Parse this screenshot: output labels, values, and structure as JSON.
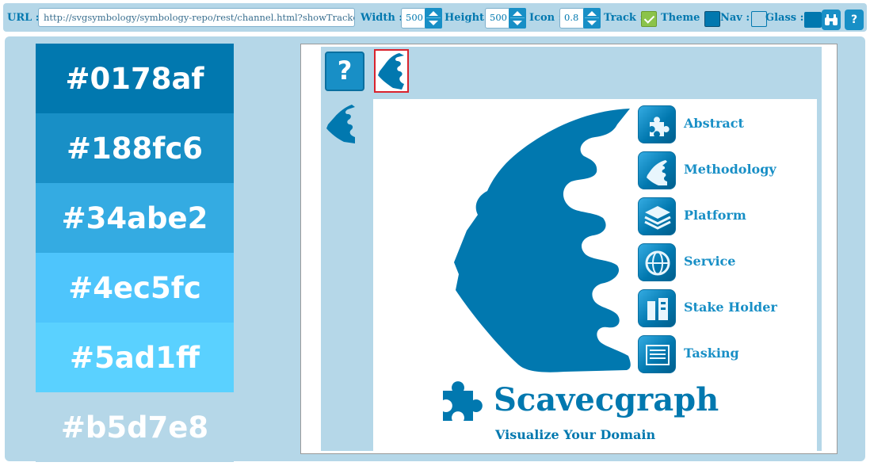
{
  "toolbar": {
    "url_label": "URL :",
    "url_value": "http://svgsymbology/symbology-repo/rest/channel.html?showTracker=truee",
    "width_label": "Width :",
    "width_value": "500",
    "height_label": "Height :",
    "height_value": "500",
    "icon_label": "Icon :",
    "icon_value": "0.8",
    "track_label": "Track :",
    "track_checked": true,
    "theme_label": "Theme :",
    "theme_color": "#0178af",
    "nav_label": "Nav :",
    "nav_color": "#b5d7e8",
    "glass_label": "Glass :",
    "glass_color": "#0178af",
    "search_icon": "binoculars-icon",
    "help_icon": "?"
  },
  "palette": [
    {
      "hex": "#0178af",
      "label": "#0178af"
    },
    {
      "hex": "#188fc6",
      "label": "#188fc6"
    },
    {
      "hex": "#34abe2",
      "label": "#34abe2"
    },
    {
      "hex": "#4ec5fc",
      "label": "#4ec5fc"
    },
    {
      "hex": "#5ad1ff",
      "label": "#5ad1ff"
    },
    {
      "hex": "#b5d7e8",
      "label": "#b5d7e8"
    }
  ],
  "preview": {
    "help_label": "?",
    "menu": [
      {
        "label": "Abstract",
        "icon": "puzzle-icon"
      },
      {
        "label": "Methodology",
        "icon": "head-profile-icon"
      },
      {
        "label": "Platform",
        "icon": "layers-icon"
      },
      {
        "label": "Service",
        "icon": "globe-gear-icon"
      },
      {
        "label": "Stake Holder",
        "icon": "building-icon"
      },
      {
        "label": "Tasking",
        "icon": "list-icon"
      }
    ],
    "brand_name": "Scavecgraph",
    "brand_tagline": "Visualize Your Domain"
  }
}
